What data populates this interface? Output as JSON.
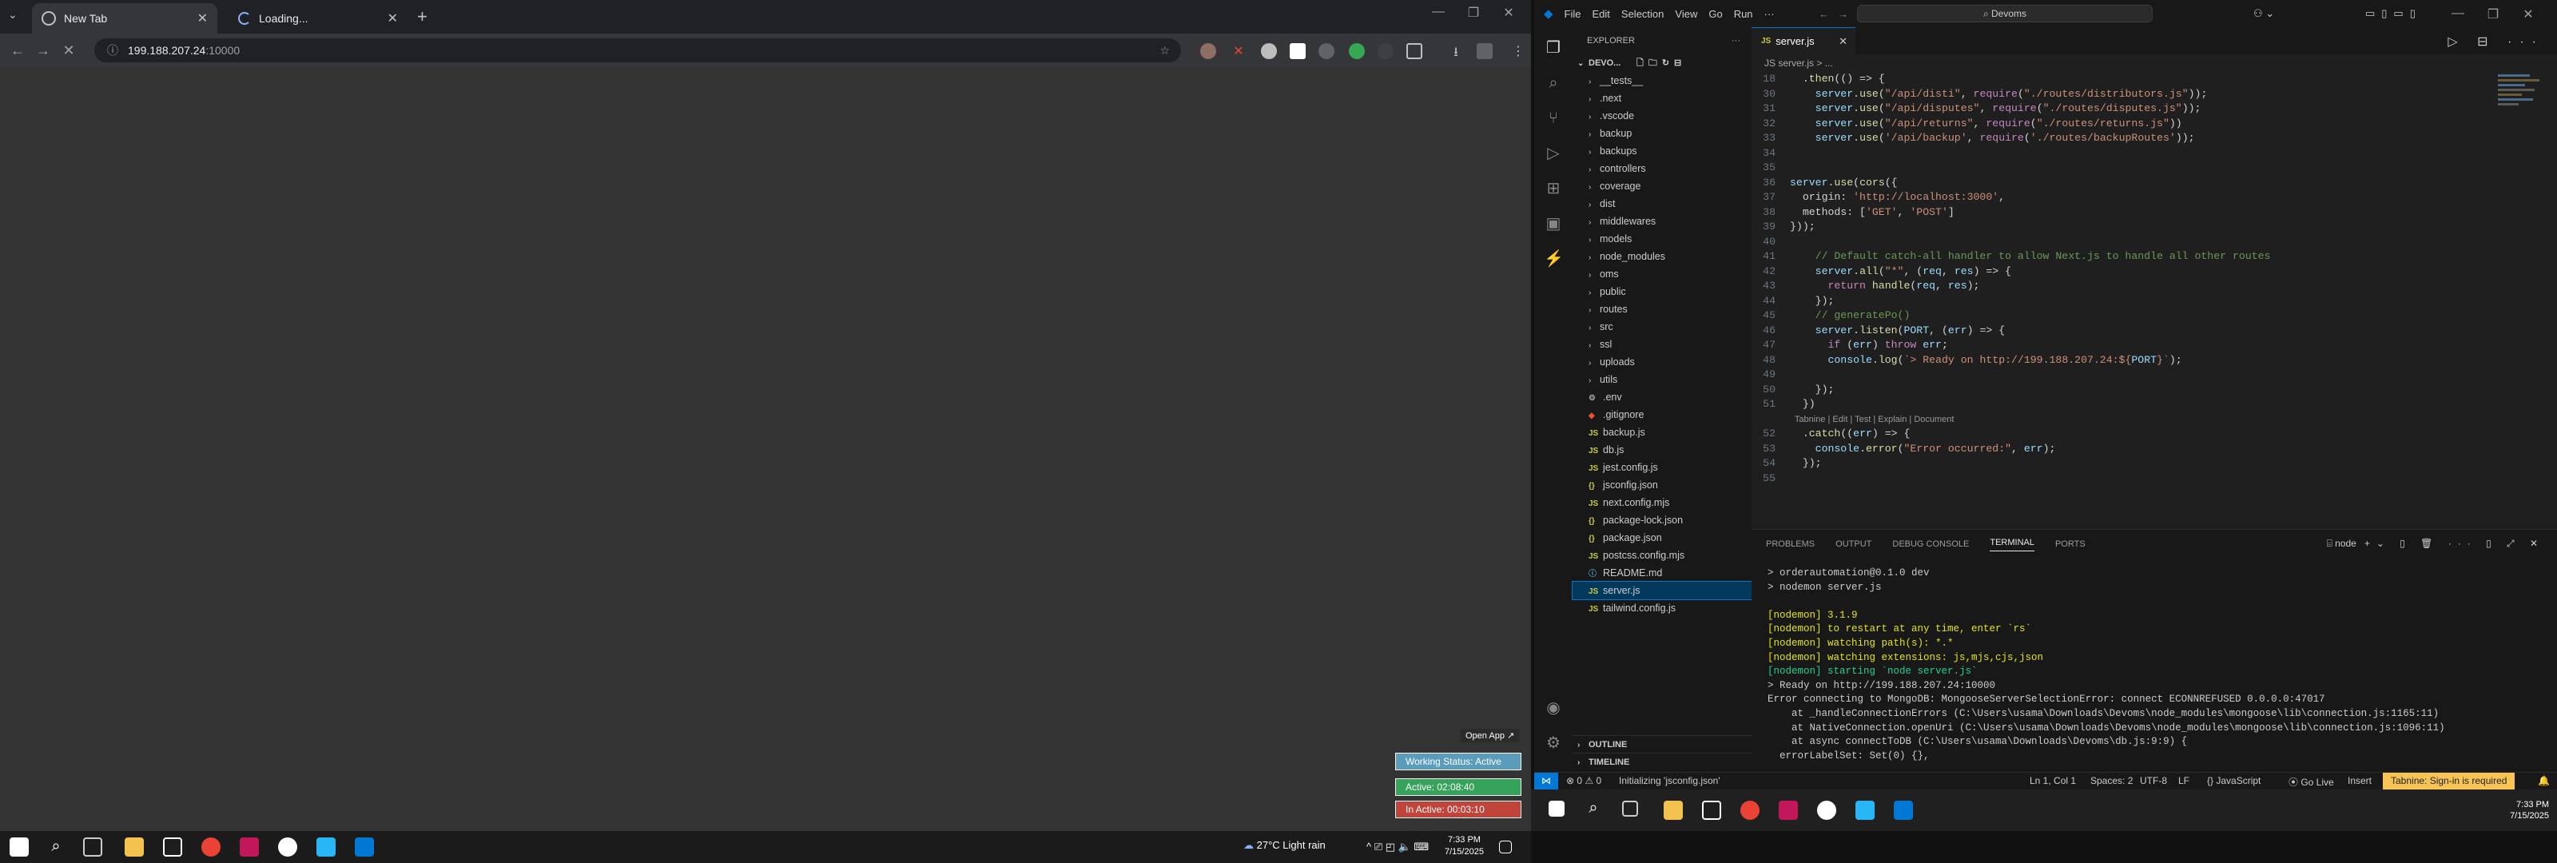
{
  "chrome": {
    "tabs": [
      {
        "title": "New Tab",
        "active": true
      },
      {
        "title": "Loading...",
        "active": false
      }
    ],
    "url_host": "199.188.207.24",
    "url_port": ":10000",
    "status_widget": {
      "open_app": "Open App ↗",
      "working": "Working Status: Active",
      "active": "Active: 02:08:40",
      "inactive": "In Active: 00:03:10"
    }
  },
  "windows_taskbar_left": {
    "weather": "27°C  Light rain",
    "time": "7:33 PM",
    "date": "7/15/2025"
  },
  "vscode": {
    "menu": [
      "File",
      "Edit",
      "Selection",
      "View",
      "Go",
      "Run",
      "···"
    ],
    "search": "Devoms",
    "explorer_label": "EXPLORER",
    "workspace": "DEVO...",
    "tree": [
      {
        "name": "__tests__",
        "type": "folder"
      },
      {
        "name": ".next",
        "type": "folder"
      },
      {
        "name": ".vscode",
        "type": "folder"
      },
      {
        "name": "backup",
        "type": "folder"
      },
      {
        "name": "backups",
        "type": "folder"
      },
      {
        "name": "controllers",
        "type": "folder"
      },
      {
        "name": "coverage",
        "type": "folder"
      },
      {
        "name": "dist",
        "type": "folder"
      },
      {
        "name": "middlewares",
        "type": "folder"
      },
      {
        "name": "models",
        "type": "folder"
      },
      {
        "name": "node_modules",
        "type": "folder"
      },
      {
        "name": "oms",
        "type": "folder"
      },
      {
        "name": "public",
        "type": "folder"
      },
      {
        "name": "routes",
        "type": "folder"
      },
      {
        "name": "src",
        "type": "folder"
      },
      {
        "name": "ssl",
        "type": "folder"
      },
      {
        "name": "uploads",
        "type": "folder"
      },
      {
        "name": "utils",
        "type": "folder"
      },
      {
        "name": ".env",
        "type": "env"
      },
      {
        "name": ".gitignore",
        "type": "git"
      },
      {
        "name": "backup.js",
        "type": "js"
      },
      {
        "name": "db.js",
        "type": "js"
      },
      {
        "name": "jest.config.js",
        "type": "js"
      },
      {
        "name": "jsconfig.json",
        "type": "json"
      },
      {
        "name": "next.config.mjs",
        "type": "js"
      },
      {
        "name": "package-lock.json",
        "type": "json"
      },
      {
        "name": "package.json",
        "type": "json"
      },
      {
        "name": "postcss.config.mjs",
        "type": "js"
      },
      {
        "name": "README.md",
        "type": "md"
      },
      {
        "name": "server.js",
        "type": "js",
        "selected": true
      },
      {
        "name": "tailwind.config.js",
        "type": "js"
      }
    ],
    "outline": "OUTLINE",
    "timeline": "TIMELINE",
    "editor_tab": "server.js",
    "breadcrumb": "JS server.js > ...",
    "code": [
      {
        "n": "18",
        "t": "  .then(() => {"
      },
      {
        "n": "30",
        "t": "    server.use(\"/api/disti\", require(\"./routes/distributors.js\"));"
      },
      {
        "n": "31",
        "t": "    server.use(\"/api/disputes\", require(\"./routes/disputes.js\"));"
      },
      {
        "n": "32",
        "t": "    server.use(\"/api/returns\", require(\"./routes/returns.js\"))"
      },
      {
        "n": "33",
        "t": "    server.use('/api/backup', require('./routes/backupRoutes'));"
      },
      {
        "n": "34",
        "t": ""
      },
      {
        "n": "35",
        "t": ""
      },
      {
        "n": "36",
        "t": "server.use(cors({"
      },
      {
        "n": "37",
        "t": "  origin: 'http://localhost:3000',"
      },
      {
        "n": "38",
        "t": "  methods: ['GET', 'POST']"
      },
      {
        "n": "39",
        "t": "}));"
      },
      {
        "n": "40",
        "t": ""
      },
      {
        "n": "41",
        "t": "    // Default catch-all handler to allow Next.js to handle all other routes"
      },
      {
        "n": "42",
        "t": "    server.all(\"*\", (req, res) => {"
      },
      {
        "n": "43",
        "t": "      return handle(req, res);"
      },
      {
        "n": "44",
        "t": "    });"
      },
      {
        "n": "45",
        "t": "    // generatePo()"
      },
      {
        "n": "46",
        "t": "    server.listen(PORT, (err) => {"
      },
      {
        "n": "47",
        "t": "      if (err) throw err;"
      },
      {
        "n": "48",
        "t": "      console.log(`> Ready on http://199.188.207.24:${PORT}`);"
      },
      {
        "n": "49",
        "t": ""
      },
      {
        "n": "50",
        "t": "    });"
      },
      {
        "n": "51",
        "t": "  })"
      },
      {
        "n": "",
        "t": "  Tabnine | Edit | Test | Explain | Document"
      },
      {
        "n": "52",
        "t": "  .catch((err) => {"
      },
      {
        "n": "53",
        "t": "    console.error(\"Error occurred:\", err);"
      },
      {
        "n": "54",
        "t": "  });"
      },
      {
        "n": "55",
        "t": ""
      }
    ],
    "panel_tabs": [
      "PROBLEMS",
      "OUTPUT",
      "DEBUG CONSOLE",
      "TERMINAL",
      "PORTS"
    ],
    "terminal_kind": "node",
    "terminal": [
      "> orderautomation@0.1.0 dev",
      "> nodemon server.js",
      "",
      "[nodemon] 3.1.9",
      "[nodemon] to restart at any time, enter `rs`",
      "[nodemon] watching path(s): *.*",
      "[nodemon] watching extensions: js,mjs,cjs,json",
      "[nodemon] starting `node server.js`",
      "> Ready on http://199.188.207.24:10000",
      "Error connecting to MongoDB: MongooseServerSelectionError: connect ECONNREFUSED 0.0.0.0:47017",
      "    at _handleConnectionErrors (C:\\Users\\usama\\Downloads\\Devoms\\node_modules\\mongoose\\lib\\connection.js:1165:11)",
      "    at NativeConnection.openUri (C:\\Users\\usama\\Downloads\\Devoms\\node_modules\\mongoose\\lib\\connection.js:1096:11)",
      "    at async connectToDB (C:\\Users\\usama\\Downloads\\Devoms\\db.js:9:9) {",
      "  errorLabelSet: Set(0) {},"
    ],
    "status": {
      "errors": "⊗ 0 ⚠ 0",
      "initializing": "Initializing 'jsconfig.json'",
      "position": "Ln 1, Col 1",
      "spaces": "Spaces: 2",
      "encoding": "UTF-8",
      "eol": "LF",
      "language": "{} JavaScript",
      "golive": "Go Live",
      "insert": "Insert",
      "tabnine": "Tabnine: Sign-in is required"
    }
  },
  "windows_taskbar_right": {
    "time": "7:33 PM",
    "date": "7/15/2025"
  }
}
